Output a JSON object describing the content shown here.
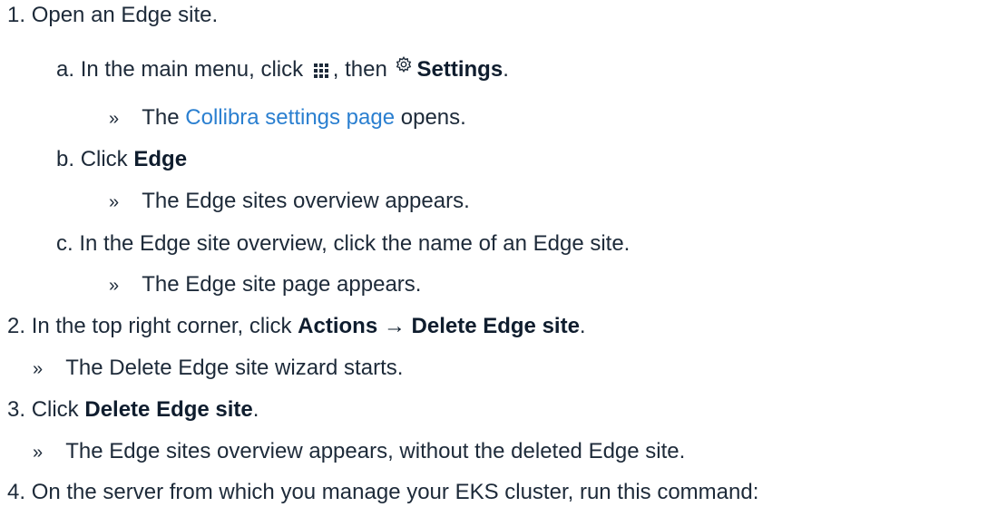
{
  "steps": [
    {
      "num": "1.",
      "text": "Open an Edge site."
    },
    {
      "num": "2.",
      "pre": "In the top right corner, click ",
      "bold": "Actions → Delete Edge site",
      "post": "."
    },
    {
      "num": "3.",
      "pre": "Click ",
      "bold": "Delete Edge site",
      "post": "."
    },
    {
      "num": "4.",
      "text": "On the server from which you manage your EKS cluster, run this command:"
    }
  ],
  "substeps": [
    {
      "letter": "a.",
      "pre": "In the main menu, click ",
      "mid": ", then ",
      "bold": "Settings",
      "post": "."
    },
    {
      "letter": "b.",
      "pre": "Click ",
      "bold": "Edge"
    },
    {
      "letter": "c.",
      "text": "In the Edge site overview, click the name of an Edge site."
    }
  ],
  "results": {
    "marker": "»",
    "settings_pre": "The ",
    "settings_link": "Collibra settings page",
    "settings_post": " opens.",
    "edge_overview": "The Edge sites overview appears.",
    "site_page": "The Edge site page appears.",
    "wizard": "The Delete Edge site wizard starts.",
    "deleted": "The Edge sites overview appears, without the deleted Edge site."
  },
  "icons": {
    "menu_icon": "grid-menu-icon",
    "settings_icon": "gear-icon",
    "link_color": "#2a7fd0",
    "text_color": "#1d2a39"
  }
}
